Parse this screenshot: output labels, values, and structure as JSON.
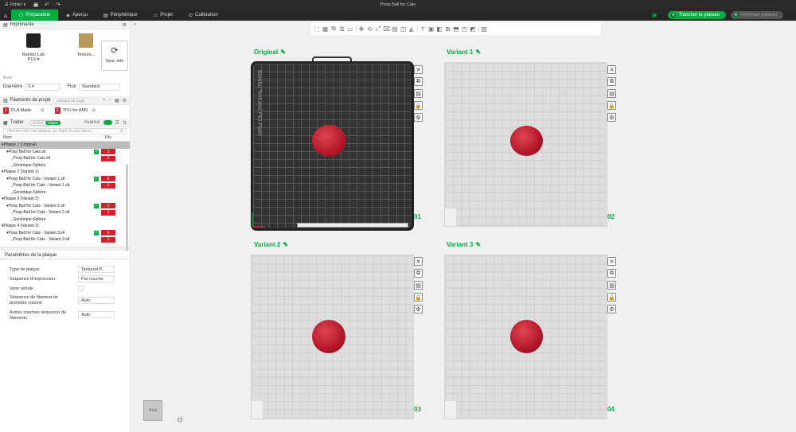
{
  "titlebar": {
    "file_label": "Fichier",
    "title": "Poop Ball for Cats"
  },
  "tabs": {
    "preparation": "Préparation",
    "apercu": "Aperçu",
    "peripherique": "Périphérique",
    "projet": "Projet",
    "calibration": "Calibration"
  },
  "actions": {
    "slice": "Trancher le plateau",
    "print": "Imprimer plateau"
  },
  "printer": {
    "section_title": "Imprimante",
    "printer_name": "Bambu Lab P1S",
    "plate_name": "Texture...",
    "sync_label": "Sync info",
    "nozzle_label": "Buse",
    "diameter_label": "Diamètre",
    "diameter_value": "0.4",
    "flow_label": "Flux",
    "flow_value": "Standard"
  },
  "filaments": {
    "section_title": "Filaments de projet",
    "purge_button": "Volumes de purge",
    "items": [
      {
        "num": "1",
        "name": "PLA Matte"
      },
      {
        "num": "2",
        "name": "TPU for AMS"
      }
    ]
  },
  "process": {
    "section_title": "Traiter",
    "toggle_global": "Global",
    "toggle_objects": "Objets",
    "advanced_label": "Avancé",
    "search_placeholder": "Recherchez une plaque, un objet ou une pièce...",
    "col_name": "Nom",
    "col_fil": "Fils."
  },
  "tree": [
    {
      "label": "Plaque 1 (Original)",
      "level": 0,
      "selected": true
    },
    {
      "label": "Poop Ball for Cats.stl",
      "level": 1,
      "check": true,
      "badge": "1"
    },
    {
      "label": "Poop Ball for Cats.stl",
      "level": 2,
      "badge": "1"
    },
    {
      "label": "Générique-Sphère",
      "level": 2
    },
    {
      "label": "Plaque 2 (Variant 1)",
      "level": 0
    },
    {
      "label": "Poop Ball for Cats - Variant 1.stl",
      "level": 1,
      "check": true,
      "badge": "1"
    },
    {
      "label": "Poop Ball for Cats - Variant 1.stl",
      "level": 2,
      "badge": "1"
    },
    {
      "label": "Générique-Sphère",
      "level": 2
    },
    {
      "label": "Plaque 3 (Variant 2)",
      "level": 0
    },
    {
      "label": "Poop Ball for Cats - Variant 2.stl",
      "level": 1,
      "check": true,
      "badge": "1"
    },
    {
      "label": "Poop Ball for Cats - Variant 2.stl",
      "level": 2,
      "badge": "1"
    },
    {
      "label": "Générique-Sphère",
      "level": 2
    },
    {
      "label": "Plaque 4 (Variant 3)",
      "level": 0
    },
    {
      "label": "Poop Ball for Cats - Variant 3.stl",
      "level": 1,
      "check": true,
      "badge": "1"
    },
    {
      "label": "Poop Ball for Cats - Variant 3.stl",
      "level": 2,
      "badge": "1"
    }
  ],
  "plate_params": {
    "tab_label": "Paramètres de la plaque",
    "plate_type_label": "Type de plaque",
    "plate_type_value": "Textured P...",
    "print_seq_label": "Séquence d'impression",
    "print_seq_value": "Par couche",
    "spiral_label": "Vase spirale",
    "first_layer_label": "Séquence de filament de première couche",
    "first_layer_value": "Auto",
    "other_layers_label": "Autres couches séquence de filaments",
    "other_layers_value": "Auto"
  },
  "plates": [
    {
      "name": "Original",
      "number": "01"
    },
    {
      "name": "Variant 1",
      "number": "02"
    },
    {
      "name": "Variant 2",
      "number": "03"
    },
    {
      "name": "Variant 3",
      "number": "04"
    }
  ],
  "bed_label": "Bambu Textured PEI Plate",
  "view_cube_label": "Haut",
  "colors": {
    "accent": "#00ae42",
    "filament_red": "#c7262e",
    "ball_red": "#c41f33"
  }
}
